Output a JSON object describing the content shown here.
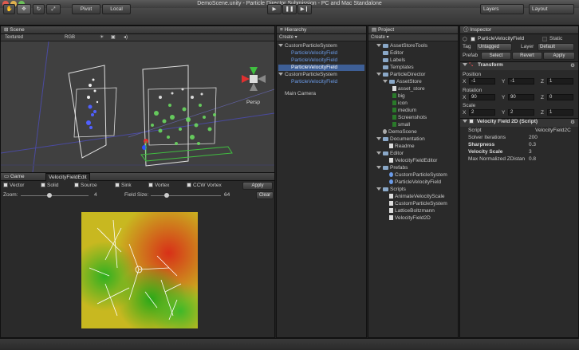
{
  "window": {
    "title": "DemoScene.unity - Particle Director Submission - PC and Mac Standalone"
  },
  "toolbar": {
    "pivot": "Pivot",
    "local": "Local",
    "layers": "Layers",
    "layout": "Layout"
  },
  "scene": {
    "tab": "Scene",
    "shading": "Textured",
    "render": "RGB",
    "persp": "Persp"
  },
  "bottom_tabs": {
    "game": "Game",
    "velocity": "VelocityFieldEdit"
  },
  "velocity_edit": {
    "toggles": [
      "Vector",
      "Solid",
      "Source",
      "Sink",
      "Vortex",
      "CCW Vortex"
    ],
    "apply": "Apply",
    "zoom_label": "Zoom:",
    "zoom_value": "4",
    "field_size_label": "Field Size:",
    "field_size_value": "64",
    "clear": "Clear"
  },
  "hierarchy": {
    "tab": "Hierarchy",
    "create": "Create",
    "items": [
      "CustomParticleSystem",
      "ParticleVelocityField",
      "ParticleVelocityField",
      "ParticleVelocityField",
      "CustomParticleSystem",
      "ParticleVelocityField",
      "Main Camera"
    ]
  },
  "project": {
    "tab": "Project",
    "create": "Create",
    "items": [
      "AssetStoreTools",
      "Editor",
      "Labels",
      "Templates",
      "ParticleDirector",
      "AssetStore",
      "asset_store",
      "big",
      "icon",
      "medium",
      "Screenshots",
      "small",
      "DemoScene",
      "Documentation",
      "Readme",
      "Editor",
      "VelocityFieldEditor",
      "Prefabs",
      "CustomParticleSystem",
      "ParticleVelocityField",
      "Scripts",
      "AnimateVelocityScale",
      "CustomParticleSystem",
      "LatticeBoltzmann",
      "VelocityField2D"
    ]
  },
  "inspector": {
    "tab": "Inspector",
    "object_name": "ParticleVelocityField",
    "static": "Static",
    "tag_label": "Tag",
    "tag_value": "Untagged",
    "layer_label": "Layer",
    "layer_value": "Default",
    "prefab_label": "Prefab",
    "prefab_select": "Select",
    "prefab_revert": "Revert",
    "prefab_apply": "Apply",
    "transform_title": "Transform",
    "position_label": "Position",
    "rotation_label": "Rotation",
    "scale_label": "Scale",
    "position": [
      "-1",
      "-1",
      "1"
    ],
    "rotation": [
      "90",
      "90",
      "0"
    ],
    "scale": [
      "2",
      "2",
      "1"
    ],
    "script_title": "Velocity Field 2D (Script)",
    "props": [
      {
        "label": "Script",
        "value": "VelocityField2C"
      },
      {
        "label": "Solver Iterations",
        "value": "200"
      },
      {
        "label": "Sharpness",
        "value": "0.3"
      },
      {
        "label": "Velocity Scale",
        "value": "3"
      },
      {
        "label": "Max Normalized ZDistan",
        "value": "0.8"
      }
    ]
  }
}
